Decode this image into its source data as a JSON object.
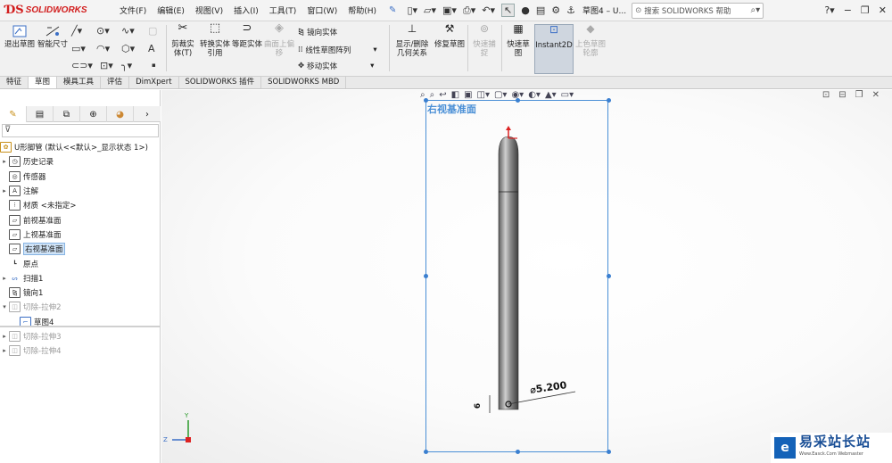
{
  "app": {
    "logo_text": "SOLIDWORKS",
    "document_title": "草图4 – U...",
    "search_placeholder": "搜索 SOLIDWORKS 帮助"
  },
  "menu": [
    "文件(F)",
    "编辑(E)",
    "视图(V)",
    "插入(I)",
    "工具(T)",
    "窗口(W)",
    "帮助(H)"
  ],
  "ribbon": {
    "exit_sketch": "退出草图",
    "smart_dimension": "智能尺寸",
    "trim_entities": "剪裁实体(T)",
    "convert_entities": "转换实体引用",
    "offset_entities": "等距实体",
    "offset_on_surface": "曲面上偏移",
    "mirror_entities": "镜向实体",
    "linear_pattern": "线性草图阵列",
    "move_entities": "移动实体",
    "display_delete_relations": "显示/删除几何关系",
    "repair_sketch": "修复草图",
    "quick_snaps": "快速捕捉",
    "rapid_sketch": "快速草图",
    "instant2d": "Instant2D",
    "shaded_sketch": "上色草图轮廓"
  },
  "tabs": [
    "特征",
    "草图",
    "模具工具",
    "评估",
    "DimXpert",
    "SOLIDWORKS 插件",
    "SOLIDWORKS MBD"
  ],
  "tree": {
    "root": "U形脚管  (默认<<默认>_显示状态 1>)",
    "items": [
      {
        "label": "历史记录",
        "icon": "history-icon"
      },
      {
        "label": "传感器",
        "icon": "sensor-icon"
      },
      {
        "label": "注解",
        "icon": "annotation-icon"
      },
      {
        "label": "材质 <未指定>",
        "icon": "material-icon"
      },
      {
        "label": "前视基准面",
        "icon": "plane-icon"
      },
      {
        "label": "上视基准面",
        "icon": "plane-icon"
      },
      {
        "label": "右视基准面",
        "icon": "plane-icon"
      },
      {
        "label": "原点",
        "icon": "origin-icon"
      },
      {
        "label": "扫描1",
        "icon": "sweep-icon"
      },
      {
        "label": "镜向1",
        "icon": "mirror-icon"
      },
      {
        "label": "切除-拉伸2",
        "icon": "cut-extrude-icon"
      },
      {
        "label": "草图4",
        "icon": "sketch-icon"
      },
      {
        "label": "切除-拉伸3",
        "icon": "cut-extrude-icon"
      },
      {
        "label": "切除-拉伸4",
        "icon": "cut-extrude-icon"
      }
    ]
  },
  "viewport": {
    "plane_label": "右视基准面",
    "dimension_diameter": "⌀5.200",
    "dimension_small": "6",
    "axis_y": "Y",
    "axis_z": "Z"
  },
  "watermark": {
    "title": "易采站长站",
    "subtitle": "Www.Easck.Com  Webmaster"
  },
  "colors": {
    "accent": "#4a8fd6",
    "brand": "#d21d1d"
  }
}
